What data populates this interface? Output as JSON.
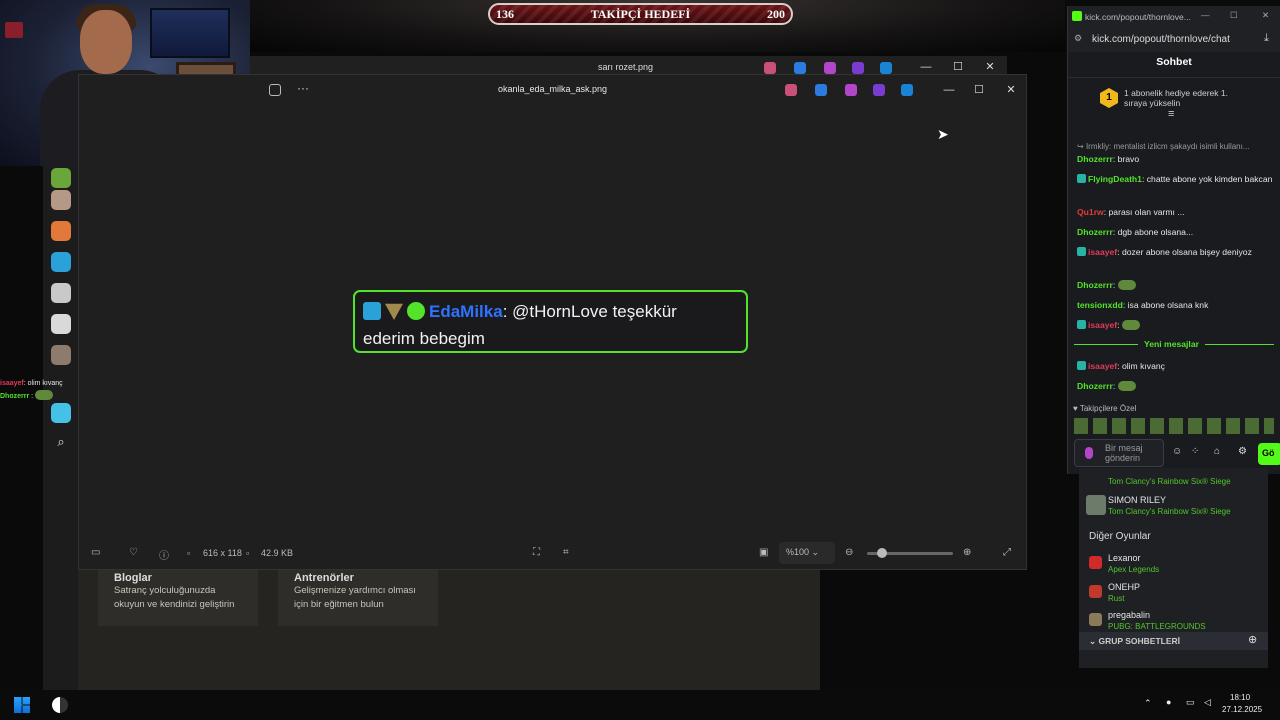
{
  "stream_overlay": {
    "follower_goal": {
      "current": "136",
      "label": "TAKİPÇİ HEDEFİ",
      "target": "200"
    },
    "left_chat": [
      {
        "user": "isaayef",
        "text": "olim kıvanç"
      },
      {
        "user": "Dhozerrr",
        "text": ""
      }
    ]
  },
  "back_window": {
    "title": "sarı rozet.png"
  },
  "photo_viewer": {
    "title": "okanla_eda_milka_ask.png",
    "image_text": {
      "username": "EdaMilka",
      "colon": ":",
      "message_part1": " @tHornLove teşekkür",
      "message_part2": "ederim bebegim"
    },
    "bottom": {
      "dimensions": "616 x 118",
      "file_size": "42.9 KB",
      "zoom": "%100"
    }
  },
  "bg_page": {
    "cards": [
      {
        "title": "Bloglar",
        "text1": "Satranç yolculuğunuzda",
        "text2": "okuyun ve kendinizi geliştirin"
      },
      {
        "title": "Antrenörler",
        "text1": "Gelişmenize yardımcı olması",
        "text2": "için bir eğitmen bulun"
      }
    ]
  },
  "chat": {
    "tab_title": "kick.com/popout/thornlove...",
    "url": "kick.com/popout/thornlove/chat",
    "header": "Sohbet",
    "pinned": {
      "rank": "1",
      "line1": "1 abonelik hediye ederek 1.",
      "line2": "sıraya yükselin"
    },
    "reply_preview": "Irmkliy: mentalist izlicm şakaydı isimli kullanı...",
    "messages": [
      {
        "user": "Dhozerrr",
        "color": "#53e32a",
        "text": "bravo"
      },
      {
        "user": "FlyingDeath1",
        "color": "#53e32a",
        "text": "chatte abone yok kimden bakcan"
      },
      {
        "user": "Qu1rw",
        "color": "#e23b3b",
        "text": "parası olan varmı ..."
      },
      {
        "user": "Dhozerrr",
        "color": "#53e32a",
        "text": "dgb abone olsana..."
      },
      {
        "user": "isaayef",
        "color": "#e23b5a",
        "text": "dozer abone olsana bişey deniyoz"
      },
      {
        "user": "Dhozerrr",
        "color": "#53e32a",
        "text": ""
      },
      {
        "user": "tensionxdd",
        "color": "#53e32a",
        "text": "isa abone olsana knk"
      },
      {
        "user": "isaayef",
        "color": "#e23b5a",
        "text": ""
      }
    ],
    "new_messages_label": "Yeni mesajlar",
    "new_messages": [
      {
        "user": "isaayef",
        "color": "#e23b5a",
        "text": "olim kıvanç"
      },
      {
        "user": "Dhozerrr",
        "color": "#53e32a",
        "text": ""
      }
    ],
    "followers_only_label": "Takipçilere Özel",
    "input_placeholder": "Bir mesaj gönderin",
    "send_label": "Gö"
  },
  "side_follow": {
    "top_game": "Tom Clancy's Rainbow Six® Siege",
    "streamer": {
      "name": "SIMON RILEY",
      "game": "Tom Clancy's Rainbow Six® Siege"
    },
    "other_games_label": "Diğer Oyunlar",
    "other_games": [
      {
        "name": "Lexanor",
        "game": "Apex Legends"
      },
      {
        "name": "ONEHP",
        "game": "Rust"
      },
      {
        "name": "pregabalin",
        "game": "PUBG: BATTLEGROUNDS"
      }
    ],
    "group_chats_label": "GRUP SOHBETLERİ"
  },
  "taskbar": {
    "time": "18:10",
    "date": "27.12.2025"
  }
}
